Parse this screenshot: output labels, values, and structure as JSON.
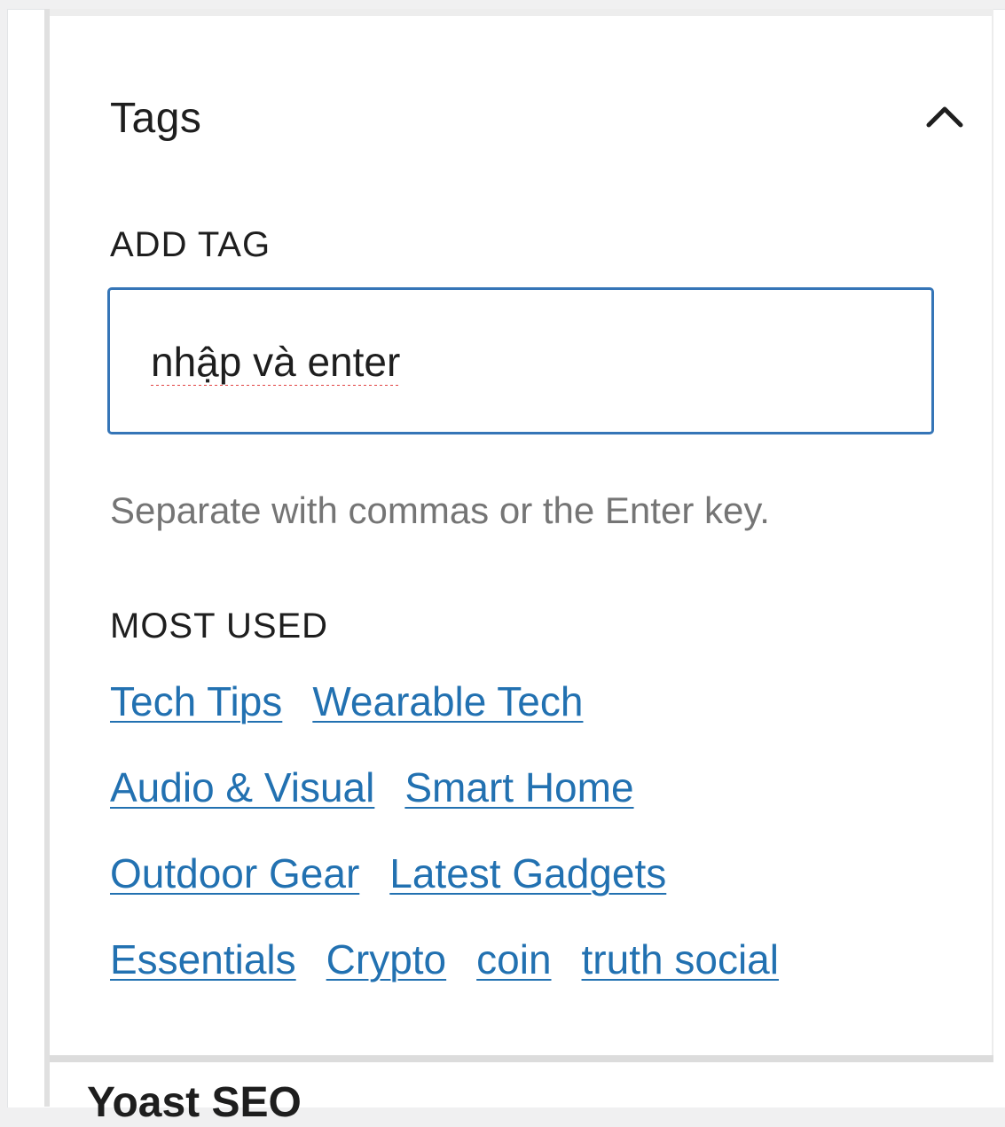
{
  "tags_panel": {
    "title": "Tags",
    "collapse_icon": "chevron-up-icon"
  },
  "add_tag": {
    "label": "ADD TAG",
    "input_value": "nhập và enter",
    "help_text": "Separate with commas or the Enter key."
  },
  "most_used": {
    "label": "MOST USED",
    "rows": [
      [
        "Tech Tips",
        "Wearable Tech"
      ],
      [
        "Audio & Visual",
        "Smart Home"
      ],
      [
        "Outdoor Gear",
        "Latest Gadgets"
      ],
      [
        "Essentials",
        "Crypto",
        "coin",
        "truth social"
      ]
    ]
  },
  "next_panel": {
    "title": "Yoast SEO"
  },
  "colors": {
    "link": "#2271b1",
    "input_border": "#3575b7",
    "help_text": "#757575",
    "text": "#1e1e1e"
  }
}
